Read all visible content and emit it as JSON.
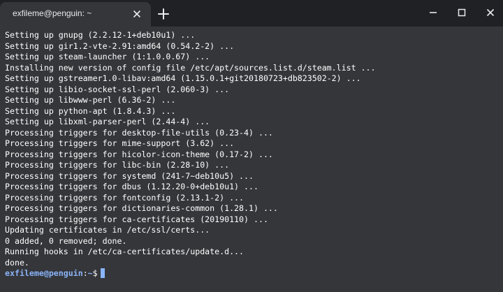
{
  "tab": {
    "title": "exfileme@penguin: ~"
  },
  "icons": {
    "tab_close": "close-icon",
    "new_tab": "plus-icon",
    "minimize": "minimize-icon",
    "maximize": "maximize-icon",
    "close": "close-icon"
  },
  "colors": {
    "background": "#35363a",
    "titlebar": "#202124",
    "text": "#ffffff",
    "prompt": "#8ab4f8"
  },
  "terminal": {
    "lines": [
      "Setting up gnupg (2.2.12-1+deb10u1) ...",
      "Setting up gir1.2-vte-2.91:amd64 (0.54.2-2) ...",
      "Setting up steam-launcher (1:1.0.0.67) ...",
      "Installing new version of config file /etc/apt/sources.list.d/steam.list ...",
      "Setting up gstreamer1.0-libav:amd64 (1.15.0.1+git20180723+db823502-2) ...",
      "Setting up libio-socket-ssl-perl (2.060-3) ...",
      "Setting up libwww-perl (6.36-2) ...",
      "Setting up python-apt (1.8.4.3) ...",
      "Setting up libxml-parser-perl (2.44-4) ...",
      "Processing triggers for desktop-file-utils (0.23-4) ...",
      "Processing triggers for mime-support (3.62) ...",
      "Processing triggers for hicolor-icon-theme (0.17-2) ...",
      "Processing triggers for libc-bin (2.28-10) ...",
      "Processing triggers for systemd (241-7~deb10u5) ...",
      "Processing triggers for dbus (1.12.20-0+deb10u1) ...",
      "Processing triggers for fontconfig (2.13.1-2) ...",
      "Processing triggers for dictionaries-common (1.28.1) ...",
      "Processing triggers for ca-certificates (20190110) ...",
      "Updating certificates in /etc/ssl/certs...",
      "0 added, 0 removed; done.",
      "Running hooks in /etc/ca-certificates/update.d...",
      "done."
    ],
    "prompt": {
      "user_host": "exfileme@penguin",
      "separator": ":",
      "path": "~",
      "symbol": "$"
    }
  }
}
